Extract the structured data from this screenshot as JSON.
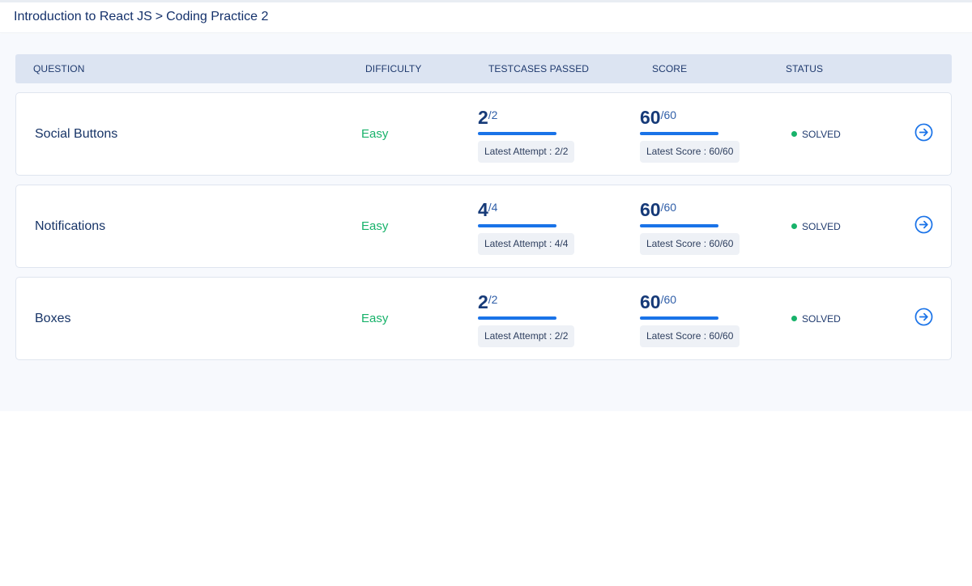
{
  "breadcrumb": {
    "course": "Introduction to React JS",
    "separator": ">",
    "page": "Coding Practice 2"
  },
  "table": {
    "headers": {
      "question": "QUESTION",
      "difficulty": "DIFFICULTY",
      "testcases": "TESTCASES PASSED",
      "score": "SCORE",
      "status": "STATUS"
    },
    "rows": [
      {
        "question": "Social Buttons",
        "difficulty": "Easy",
        "testcases_passed": "2",
        "testcases_total": "/2",
        "testcases_fraction": 1.0,
        "latest_attempt": "Latest Attempt : 2/2",
        "score": "60",
        "score_total": "/60",
        "score_fraction": 1.0,
        "latest_score": "Latest Score : 60/60",
        "status": "SOLVED",
        "action_icon": "arrow-right-circle-icon"
      },
      {
        "question": "Notifications",
        "difficulty": "Easy",
        "testcases_passed": "4",
        "testcases_total": "/4",
        "testcases_fraction": 1.0,
        "latest_attempt": "Latest Attempt : 4/4",
        "score": "60",
        "score_total": "/60",
        "score_fraction": 1.0,
        "latest_score": "Latest Score : 60/60",
        "status": "SOLVED",
        "action_icon": "arrow-right-circle-icon"
      },
      {
        "question": "Boxes",
        "difficulty": "Easy",
        "testcases_passed": "2",
        "testcases_total": "/2",
        "testcases_fraction": 1.0,
        "latest_attempt": "Latest Attempt : 2/2",
        "score": "60",
        "score_total": "/60",
        "score_fraction": 1.0,
        "latest_score": "Latest Score : 60/60",
        "status": "SOLVED",
        "action_icon": "arrow-right-circle-icon"
      }
    ]
  },
  "colors": {
    "accent": "#1a73e8",
    "easy": "#17b26a",
    "solved_dot": "#17b26a",
    "header_bg": "#dce4f2",
    "title": "#14316b"
  }
}
